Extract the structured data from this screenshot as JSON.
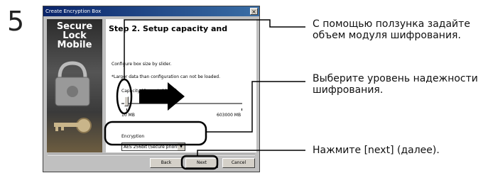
{
  "step_number": "5",
  "window": {
    "title": "Create Encryption Box",
    "close_glyph": "×",
    "sidebar_logo": [
      "Secure",
      "Lock",
      "Mobile"
    ],
    "heading": "Step 2. Setup capacity and",
    "instruction_1": "Configure box size by slider.",
    "instruction_2": "*Larger data than configuration can not be loaded.",
    "capacity_label": "Capacity (Current: 10 MB)",
    "slider_min": "10 MB",
    "slider_max": "603000 MB",
    "slider_value_mb": 10,
    "encryption_label": "Encryption",
    "encryption_selected": "AES 256bit (Secure priority)",
    "buttons": {
      "back": "Back",
      "next": "Next",
      "cancel": "Cancel"
    }
  },
  "callouts": {
    "slider": "С помощью ползунка задайте объем модуля шифрования.",
    "encryption": "Выберите уровень надежности шифрования.",
    "next": "Нажмите [next] (далее)."
  },
  "colors": {
    "titlebar": "#0a246a",
    "window_face": "#c0c0c0",
    "highlight_stroke": "#000000"
  }
}
